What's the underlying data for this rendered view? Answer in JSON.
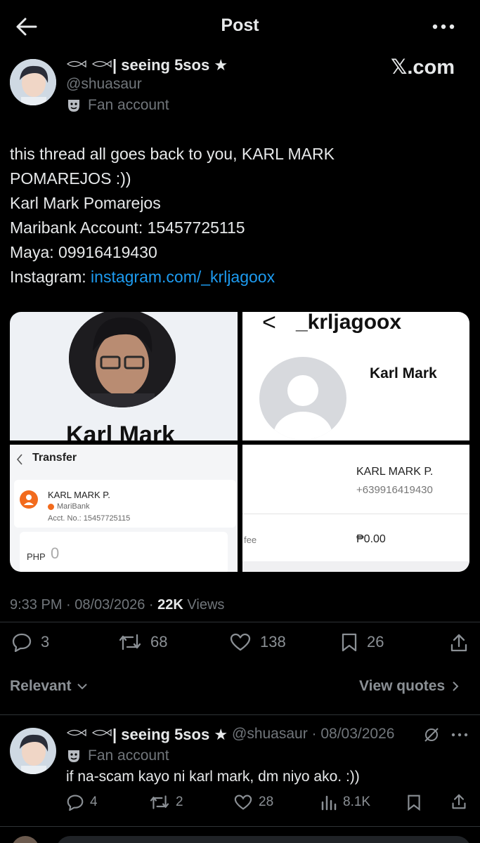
{
  "header": {
    "title": "Post"
  },
  "author": {
    "display_name": "| seeing 5sos ★",
    "handle": "@shuasaur",
    "badge": "Fan account",
    "watermark": "𝕏.com"
  },
  "post": {
    "lines": [
      "this thread all goes back to you, KARL MARK",
      "POMAREJOS :))",
      "Karl Mark Pomarejos",
      "Maribank Account: 15457725115",
      "Maya: 09916419430"
    ],
    "instagram_prefix": "Instagram: ",
    "instagram_link": "instagram.com/_krljagoox"
  },
  "media": {
    "c1_name": "Karl Mark",
    "c2_back": "<",
    "c2_username": "_krljagoox",
    "c2_name": "Karl Mark",
    "c3_title": "Transfer",
    "c3_recipient": "KARL MARK P.",
    "c3_bank": "MariBank",
    "c3_acct": "Acct. No.: 15457725115",
    "c3_currency": "PHP",
    "c3_amount": "0",
    "c4_name": "KARL MARK P.",
    "c4_phone": "+639916419430",
    "c4_fee_label": "fee",
    "c4_fee_value": "₱0.00"
  },
  "meta": {
    "time": "9:33 PM · 08/03/2026 · ",
    "views_count": "22K",
    "views_label": " Views"
  },
  "actions": {
    "replies": "3",
    "reposts": "68",
    "likes": "138",
    "bookmarks": "26"
  },
  "filter": {
    "sort": "Relevant",
    "quotes": "View quotes"
  },
  "reply": {
    "display_name": "| seeing 5sos ★",
    "handle_date": "@shuasaur · 08/03/2026",
    "badge": "Fan account",
    "text": "if na-scam kayo ni karl mark, dm niyo ako. :))",
    "replies": "4",
    "reposts": "2",
    "likes": "28",
    "views": "8.1K"
  },
  "colors": {
    "link": "#1d9bf0",
    "muted": "#71767b",
    "bg": "#000000",
    "maribank": "#f26b1d"
  }
}
